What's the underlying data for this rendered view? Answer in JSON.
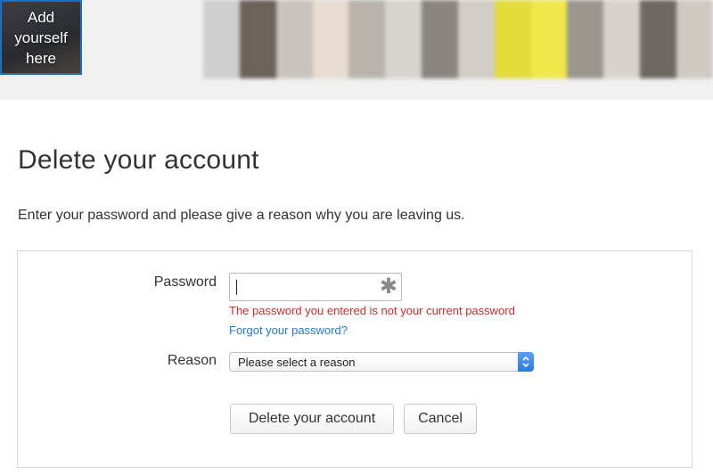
{
  "banner": {
    "add_tile_label": "Add yourself here",
    "photo_colors": [
      "#cfcfcf",
      "#6b625a",
      "#c8c3bc",
      "#e7dccf",
      "#b9b3ac",
      "#d6d4cf",
      "#8b8580",
      "#d2cdc6",
      "#e2dd3a",
      "#f0e84a",
      "#9c968f",
      "#d7d2cb",
      "#6f6862",
      "#cfc9c2"
    ]
  },
  "page": {
    "title": "Delete your account",
    "intro": "Enter your password and please give a reason why you are leaving us."
  },
  "form": {
    "password_label": "Password",
    "password_value": "",
    "required_marker": "✱",
    "error_message": "The password you entered is not your current password",
    "forgot_link": "Forgot your password?",
    "reason_label": "Reason",
    "reason_selected": "Please select a reason",
    "reason_options": [
      "Please select a reason"
    ],
    "delete_button": "Delete your account",
    "cancel_button": "Cancel"
  },
  "colors": {
    "error": "#cc2b2b",
    "link": "#2a78c5",
    "accent": "#1d6fc0"
  }
}
